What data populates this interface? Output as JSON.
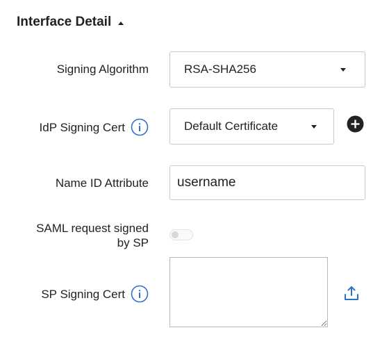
{
  "section": {
    "title": "Interface Detail"
  },
  "fields": {
    "signing_algorithm": {
      "label": "Signing Algorithm",
      "value": "RSA-SHA256"
    },
    "idp_signing_cert": {
      "label": "IdP Signing Cert",
      "value": "Default Certificate"
    },
    "name_id_attribute": {
      "label": "Name ID Attribute",
      "value": "username"
    },
    "saml_request_signed": {
      "label_line1": "SAML request signed",
      "label_line2": "by SP",
      "enabled": false
    },
    "sp_signing_cert": {
      "label": "SP Signing Cert",
      "value": ""
    }
  },
  "colors": {
    "info_icon": "#2f6fc6",
    "upload_icon": "#2f6fc6",
    "add_icon": "#222222"
  },
  "icons": [
    "caret-up-icon",
    "caret-down-icon",
    "info-icon",
    "plus-circle-icon",
    "upload-icon"
  ]
}
